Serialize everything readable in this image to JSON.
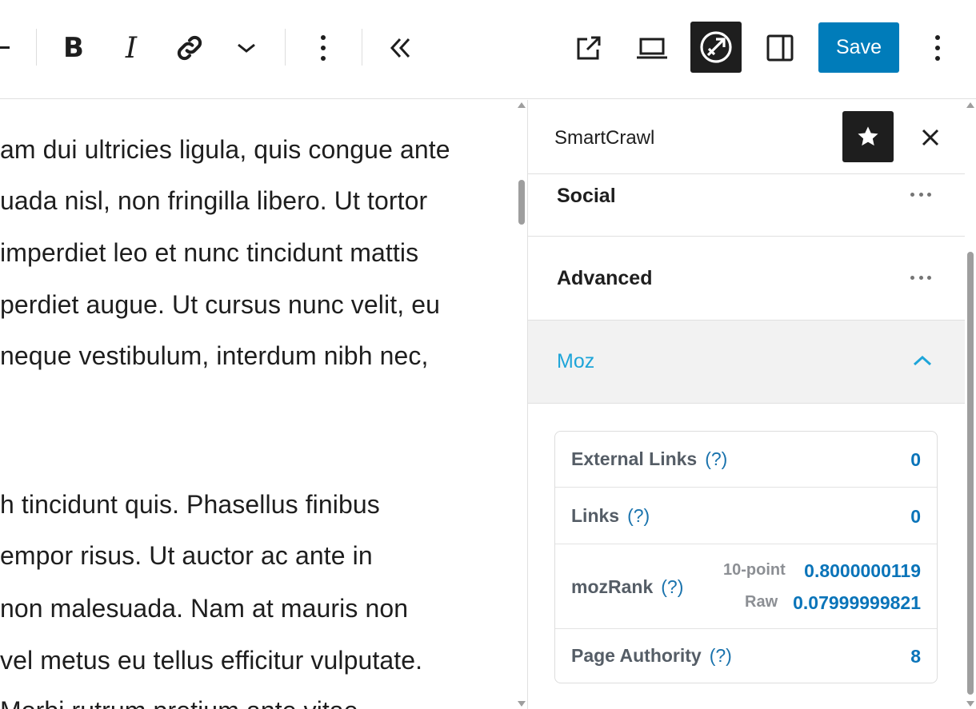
{
  "toolbar": {
    "save_label": "Save"
  },
  "editor": {
    "lines": [
      "am dui ultricies ligula, quis congue ante",
      "uada nisl, non fringilla libero. Ut tortor",
      " imperdiet leo et nunc tincidunt mattis",
      "perdiet augue. Ut cursus nunc velit, eu",
      "neque vestibulum, interdum nibh nec,",
      "h tincidunt quis. Phasellus finibus",
      "empor risus. Ut auctor ac ante in",
      " non malesuada. Nam at mauris non",
      " vel metus eu tellus efficitur vulputate.",
      "  Morbi rutrum pretium ante vitae"
    ]
  },
  "sidebar": {
    "title": "SmartCrawl",
    "panels": {
      "social": "Social",
      "advanced": "Advanced",
      "moz": "Moz"
    },
    "moz": {
      "help": "(?)",
      "external_links_label": "External Links",
      "external_links_value": "0",
      "links_label": "Links",
      "links_value": "0",
      "mozrank_label": "mozRank",
      "ten_point_label": "10-point",
      "ten_point_value": "0.8000000119",
      "raw_label": "Raw",
      "raw_value": "0.07999999821",
      "page_authority_label": "Page Authority",
      "page_authority_value": "8"
    }
  },
  "icons": {
    "minus": "minus-icon",
    "link": "link-icon",
    "chevron": "chevron-down-icon",
    "more": "more-vertical-icon",
    "collapse": "double-chevron-left-icon",
    "external": "external-link-icon",
    "preview": "laptop-icon",
    "plugin": "smartcrawl-icon",
    "sidebar": "sidebar-toggle-icon",
    "star": "star-icon",
    "close": "close-icon"
  },
  "colors": {
    "primary": "#007cba",
    "dark": "#1e1e1e",
    "moz_accent": "#1ea5d9",
    "value_blue": "#0a74b9"
  }
}
